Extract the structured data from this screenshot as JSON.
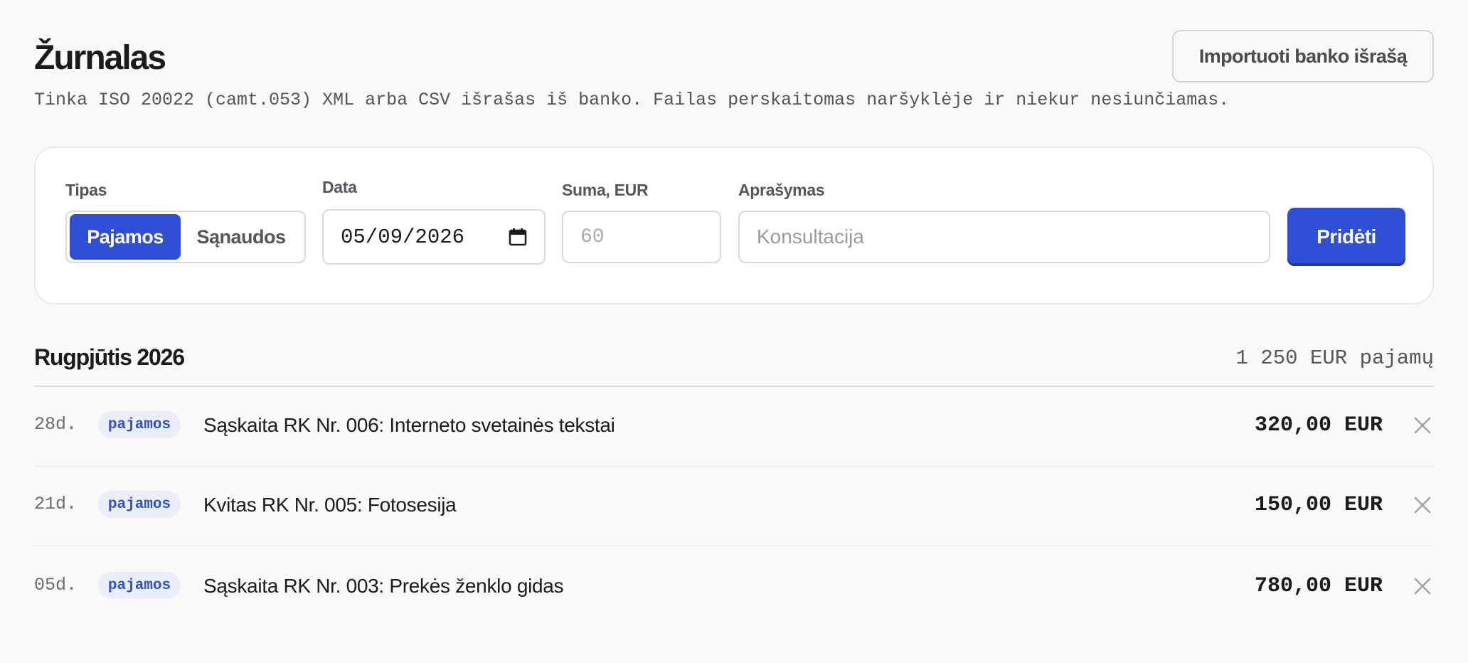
{
  "header": {
    "title": "Žurnalas",
    "subtitle": "Tinka ISO 20022 (camt.053) XML arba CSV išrašas iš banko. Failas perskaitomas naršyklėje ir niekur nesiunčiamas.",
    "import_button": "Importuoti banko išrašą"
  },
  "form": {
    "type_label": "Tipas",
    "type_options": [
      "Pajamos",
      "Sąnaudos"
    ],
    "type_selected": "Pajamos",
    "date_label": "Data",
    "date_value": "05/09/2026",
    "amount_label": "Suma, EUR",
    "amount_placeholder": "60",
    "description_label": "Aprašymas",
    "description_placeholder": "Konsultacija",
    "add_button": "Pridėti"
  },
  "month": {
    "title": "Rugpjūtis 2026",
    "summary": "1 250 EUR pajamų",
    "entries": [
      {
        "day": "28d.",
        "type": "pajamos",
        "description": "Sąskaita RK Nr. 006: Interneto svetainės tekstai",
        "amount": "320,00 EUR"
      },
      {
        "day": "21d.",
        "type": "pajamos",
        "description": "Kvitas RK Nr. 005: Fotosesija",
        "amount": "150,00 EUR"
      },
      {
        "day": "05d.",
        "type": "pajamos",
        "description": "Sąskaita RK Nr. 003: Prekės ženklo gidas",
        "amount": "780,00 EUR"
      }
    ]
  },
  "colors": {
    "accent": "#2f4fd6",
    "background": "#faf9f7",
    "badge_bg": "#eaeefb"
  },
  "icons": {
    "date_picker": "calendar-icon",
    "delete": "close-icon"
  }
}
